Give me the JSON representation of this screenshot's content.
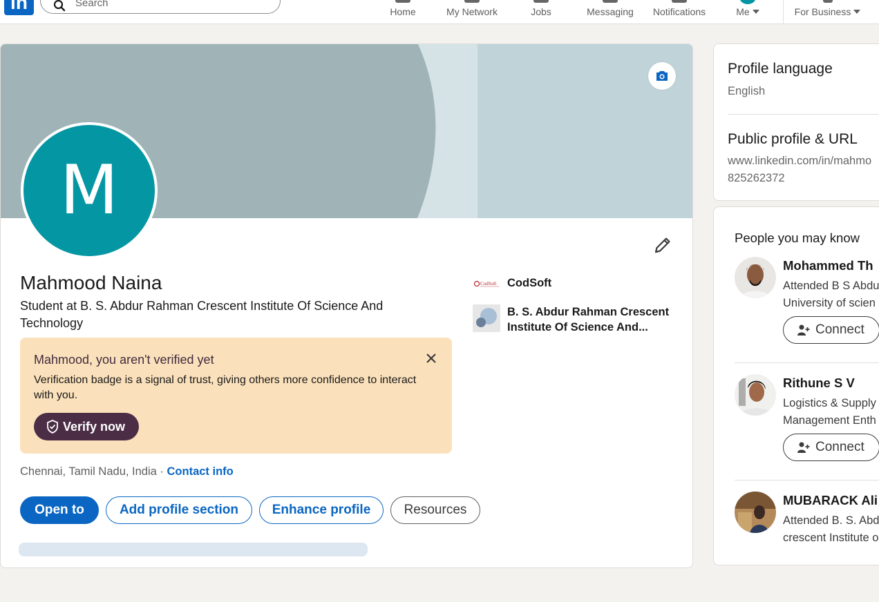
{
  "nav": {
    "logo": "in",
    "search_placeholder": "Search",
    "items": [
      {
        "label": "Home"
      },
      {
        "label": "My Network"
      },
      {
        "label": "Jobs"
      },
      {
        "label": "Messaging"
      },
      {
        "label": "Notifications"
      },
      {
        "label": "Me"
      },
      {
        "label": "For Business"
      }
    ]
  },
  "profile": {
    "avatar_letter": "M",
    "name": "Mahmood Naina",
    "headline": "Student at B. S. Abdur Rahman Crescent Institute Of Science And Technology",
    "organizations": [
      {
        "name": "CodSoft",
        "logo_text": "CodSoft"
      },
      {
        "name": "B. S. Abdur Rahman Crescent Institute Of Science And..."
      }
    ],
    "verification": {
      "title": "Mahmood, you aren't verified yet",
      "text": "Verification badge is a signal of trust, giving others more confidence to interact with you.",
      "button": "Verify now"
    },
    "location": "Chennai, Tamil Nadu, India",
    "separator": "·",
    "contact_link": "Contact info",
    "actions": {
      "open_to": "Open to",
      "add_section": "Add profile section",
      "enhance": "Enhance profile",
      "resources": "Resources"
    }
  },
  "sidebar": {
    "profile_language": {
      "title": "Profile language",
      "value": "English"
    },
    "public_profile": {
      "title": "Public profile & URL",
      "url_line1": "www.linkedin.com/in/mahmo",
      "url_line2": "825262372"
    },
    "pymk": {
      "title": "People you may know",
      "people": [
        {
          "name": "Mohammed Th",
          "desc1": "Attended B S Abdu",
          "desc2": "University of scien",
          "button": "Connect"
        },
        {
          "name": "Rithune S V",
          "desc1": "Logistics & Supply",
          "desc2": "Management Enth",
          "button": "Connect"
        },
        {
          "name": "MUBARACK Ali",
          "desc1": "Attended B. S. Abd",
          "desc2": "crescent Institute o"
        }
      ]
    }
  },
  "colors": {
    "brand": "#0a66c2",
    "avatar_bg": "#0596a3",
    "verify_bg": "#fbe1bb",
    "verify_btn": "#4b2d45"
  }
}
